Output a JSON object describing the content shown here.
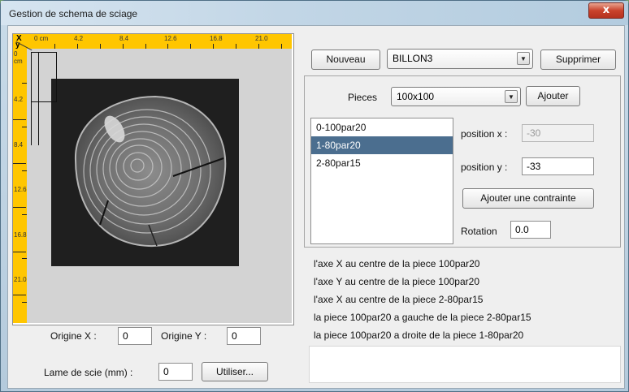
{
  "window": {
    "title": "Gestion de schema de sciage",
    "close_glyph": "x"
  },
  "ruler": {
    "axis_x": "X",
    "axis_y": "y",
    "x_labels": [
      "0 cm",
      "4.2",
      "8.4",
      "12.6",
      "16.8",
      "21.0"
    ],
    "y_labels": [
      "0 cm",
      "4.2",
      "8.4",
      "12.6",
      "16.8",
      "21.0"
    ],
    "color": "#ffc600"
  },
  "origin": {
    "x_label": "Origine X :",
    "x_value": "0",
    "y_label": "Origine Y :",
    "y_value": "0"
  },
  "blade": {
    "label": "Lame de scie (mm) :",
    "value": "0",
    "use_button": "Utiliser..."
  },
  "toolbar": {
    "new_button": "Nouveau",
    "billon_selected": "BILLON3",
    "delete_button": "Supprimer"
  },
  "pieces": {
    "label": "Pieces",
    "selected": "100x100",
    "add_button": "Ajouter",
    "list": [
      "0-100par20",
      "1-80par20",
      "2-80par15"
    ],
    "selected_index": 1,
    "selection_color": "#4b6e8f"
  },
  "position": {
    "x_label": "position x :",
    "x_value": "-30",
    "y_label": "position y :",
    "y_value": "-33"
  },
  "constraint_button": "Ajouter une contrainte",
  "rotation": {
    "label": "Rotation",
    "value": "0.0"
  },
  "constraints": [
    "l'axe X au centre de la piece 100par20",
    "l'axe Y au centre de la piece 100par20",
    "l'axe X au centre de la piece 2-80par15",
    "la piece 100par20 a gauche de la piece 2-80par15",
    "la piece 100par20 a droite de la piece 1-80par20"
  ]
}
